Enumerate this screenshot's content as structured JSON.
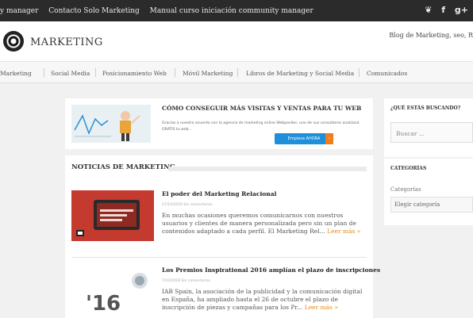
{
  "topbar": {
    "links": [
      "y manager",
      "Contacto Solo Marketing",
      "Manual curso iniciación community manager"
    ],
    "social": [
      "❦",
      "f",
      "g+"
    ]
  },
  "header": {
    "logo_text": "MARKETING",
    "tagline": "Blog de Marketing, seo, R"
  },
  "nav": {
    "items": [
      "Marketing",
      "Social Media",
      "Posicionamiento Web",
      "Móvil Marketing",
      "Libros de Marketing y Social Media",
      "Comunicados"
    ]
  },
  "promo": {
    "title": "CÓMO CONSEGUIR MÁS VISITAS Y VENTAS PARA TU WEB",
    "text": "Gracias a nuestro acuerdo con la agencia de marketing online Webpositer, uno de sus consultores analizará GRATIS tu web...",
    "button": "Empieza AHORA",
    "button_arrow": "›"
  },
  "news": {
    "heading": "NOTICIAS DE MARKETING",
    "articles": [
      {
        "title": "El poder del Marketing Relacional",
        "meta": "27/10/2016   Sin comentarios",
        "excerpt": "En muchas ocasiones queremos comunicarnos con nuestros usuarios y clientes de manera personalizada pero sin un plan de contenidos adaptado a cada perfil. El Marketing Rel...",
        "more": "Leer más »",
        "thumb_text": "EL PODER DEL MARKETING RELACIONAL"
      },
      {
        "title": "Los Premios Inspirational 2016 amplían el plazo de inscripciones",
        "meta": "7/10/2016   Sin comentarios",
        "excerpt": "IAB Spain, la asociación de la publicidad y la comunicación digital en España, ha ampliado hasta el 26 de octubre el plazo de inscripción de piezas y campañas para los Pr...",
        "more": "Leer más »",
        "thumb_text": "'16"
      }
    ]
  },
  "sidebar": {
    "search_heading": "¿QUÉ ESTÁS BUSCANDO?",
    "search_placeholder": "Buscar ...",
    "categories_heading": "CATEGORÍAS",
    "categories_label": "Categorías",
    "categories_select": "Elegir categoría"
  },
  "colors": {
    "topbar": "#2b2b2b",
    "button": "#1e8fd8",
    "button_accent": "#f07d1d",
    "read_more": "#e58a17"
  }
}
